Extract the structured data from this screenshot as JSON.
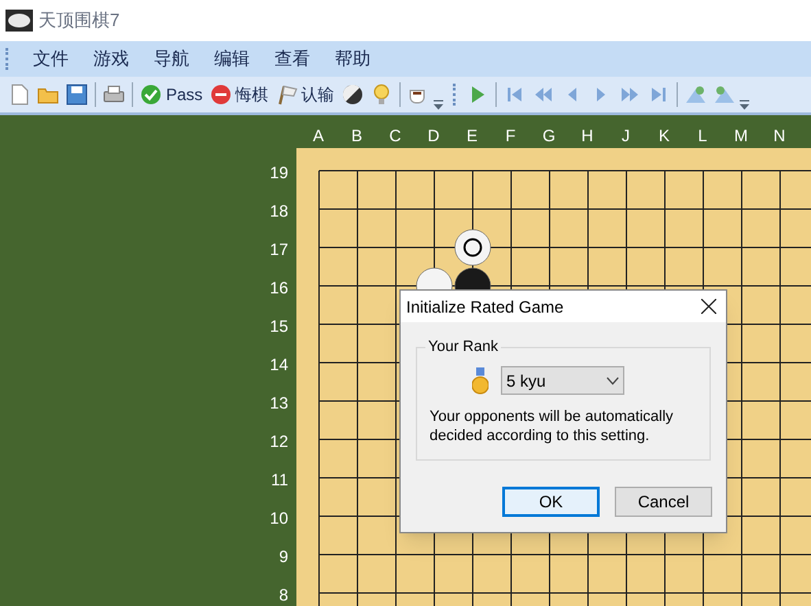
{
  "window": {
    "title": "天顶围棋7"
  },
  "menu": [
    "文件",
    "游戏",
    "导航",
    "编辑",
    "查看",
    "帮助"
  ],
  "toolbar": [
    {
      "kind": "new"
    },
    {
      "kind": "open"
    },
    {
      "kind": "save"
    },
    {
      "kind": "separator"
    },
    {
      "kind": "print"
    },
    {
      "kind": "separator"
    },
    {
      "kind": "pass",
      "label": "Pass"
    },
    {
      "kind": "undo",
      "label": "悔棋"
    },
    {
      "kind": "resign",
      "label": "认输"
    },
    {
      "kind": "stones"
    },
    {
      "kind": "hint"
    },
    {
      "kind": "separator"
    },
    {
      "kind": "cup"
    },
    {
      "kind": "overflow"
    },
    {
      "kind": "grip"
    },
    {
      "kind": "play"
    },
    {
      "kind": "separator"
    },
    {
      "kind": "first"
    },
    {
      "kind": "fast-back"
    },
    {
      "kind": "back"
    },
    {
      "kind": "forward"
    },
    {
      "kind": "fast-forward"
    },
    {
      "kind": "last"
    },
    {
      "kind": "separator"
    },
    {
      "kind": "tree-left"
    },
    {
      "kind": "tree-right"
    },
    {
      "kind": "overflow"
    }
  ],
  "board": {
    "columns": [
      "A",
      "B",
      "C",
      "D",
      "E",
      "F",
      "G",
      "H",
      "J",
      "K",
      "L",
      "M",
      "N"
    ],
    "rows": [
      "19",
      "18",
      "17",
      "16",
      "15",
      "14",
      "13",
      "12",
      "11",
      "10",
      "9",
      "8"
    ],
    "stones": [
      {
        "kind": "white",
        "marked": true
      },
      {
        "kind": "white",
        "marked": false
      },
      {
        "kind": "black",
        "marked": false
      }
    ]
  },
  "dialog": {
    "title": "Initialize Rated Game",
    "group": "Your Rank",
    "rank": "5 kyu",
    "note": "Your opponents will be automatically decided according to this setting.",
    "buttons": [
      {
        "label": "OK",
        "selected": true
      },
      {
        "label": "Cancel",
        "selected": false
      }
    ]
  }
}
